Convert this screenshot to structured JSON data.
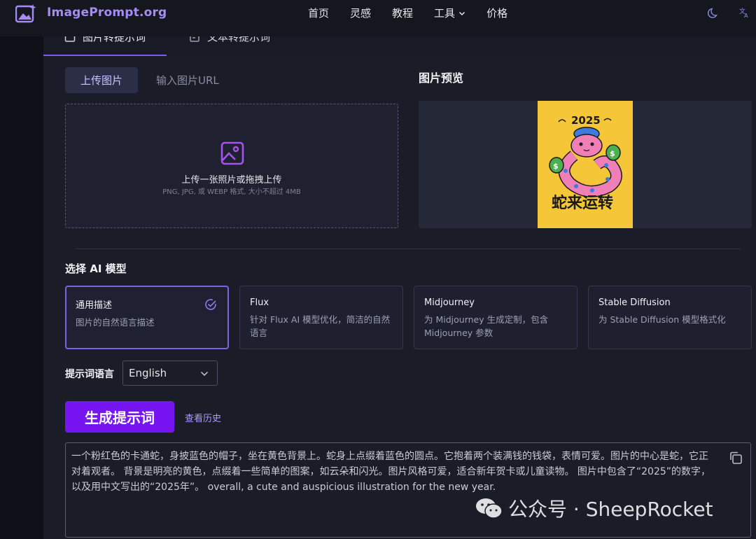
{
  "header": {
    "app_name": "ImagePrompt.org",
    "nav": [
      {
        "label": "首页"
      },
      {
        "label": "灵感"
      },
      {
        "label": "教程"
      },
      {
        "label": "工具"
      },
      {
        "label": "价格"
      }
    ],
    "theme_icon": "moon-icon",
    "language_icon": "translate-icon"
  },
  "tabs": [
    {
      "label": "图片转提示词",
      "icon": "image-edit-icon",
      "active": true
    },
    {
      "label": "文本转提示词",
      "icon": "text-edit-icon",
      "active": false
    }
  ],
  "upload": {
    "subtabs": [
      {
        "label": "上传图片",
        "active": true
      },
      {
        "label": "输入图片URL",
        "active": false
      }
    ],
    "dropzone_title": "上传一张照片或拖拽上传",
    "dropzone_hint": "PNG, JPG, 或 WEBP 格式, 大小不超过 4MB"
  },
  "preview": {
    "title": "图片预览",
    "image_year": "2025",
    "image_caption": "蛇来运转"
  },
  "models": {
    "title": "选择 AI 模型",
    "items": [
      {
        "name": "通用描述",
        "desc": "图片的自然语言描述",
        "selected": true
      },
      {
        "name": "Flux",
        "desc": "针对 Flux AI 模型优化，简洁的自然语言",
        "selected": false
      },
      {
        "name": "Midjourney",
        "desc": "为 Midjourney 生成定制，包含 Midjourney 参数",
        "selected": false
      },
      {
        "name": "Stable Diffusion",
        "desc": "为 Stable Diffusion 模型格式化",
        "selected": false
      }
    ]
  },
  "language": {
    "label": "提示词语言",
    "value": "English"
  },
  "actions": {
    "generate_label": "生成提示词",
    "history_label": "查看历史"
  },
  "result": {
    "text": "一个粉红色的卡通蛇，身披蓝色的帽子，坐在黄色背景上。蛇身上点缀着蓝色的圆点。它抱着两个装满钱的钱袋，表情可爱。图片的中心是蛇，它正对着观者。 背景是明亮的黄色，点缀着一些简单的图案，如云朵和闪光。图片风格可爱，适合新年贺卡或儿童读物。 图片中包含了“2025”的数字，以及用中文写出的“2025年”。 overall, a cute and auspicious illustration for the new year."
  },
  "watermark": {
    "text": "公众号 · SheepRocket"
  },
  "colors": {
    "accent": "#7714f2",
    "brand": "#a88bf6",
    "selected_border": "#7b63e6"
  }
}
